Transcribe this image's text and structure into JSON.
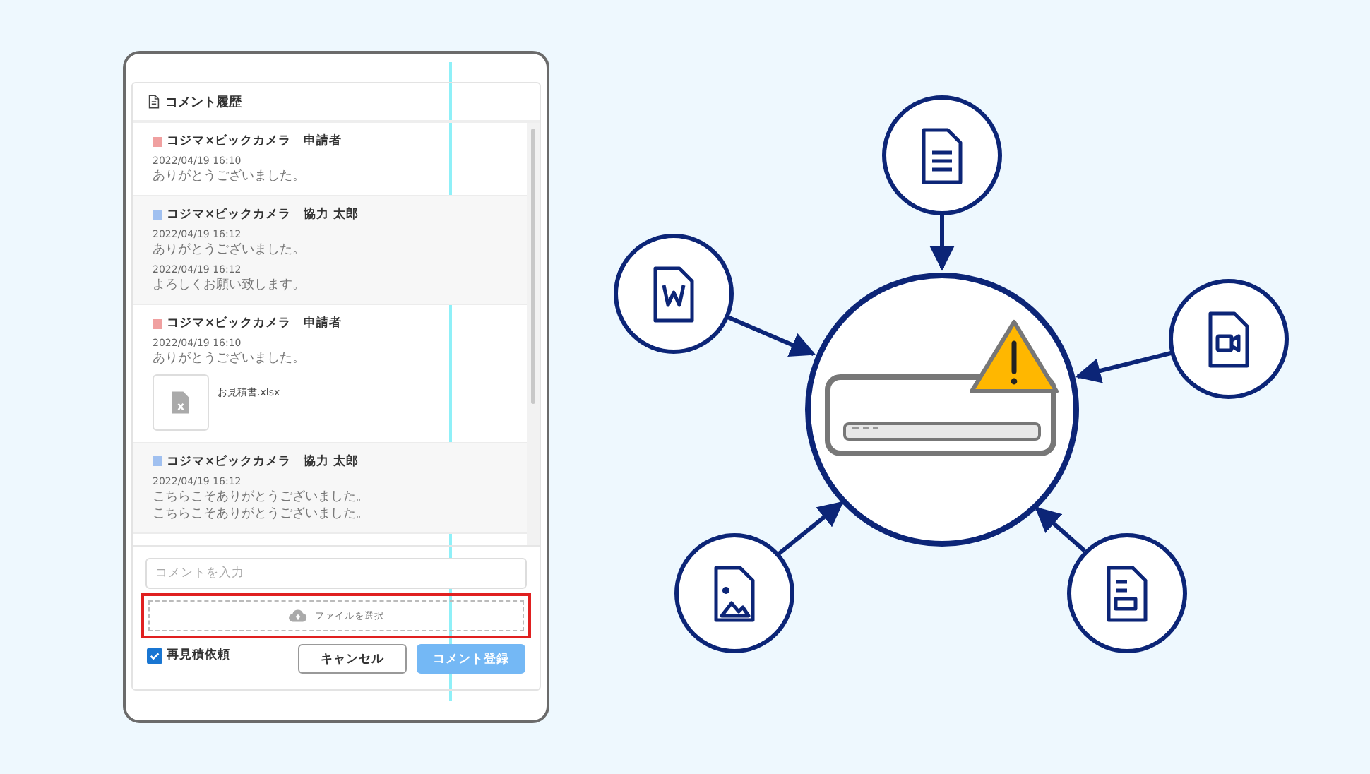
{
  "panel": {
    "title": "コメント履歴",
    "comments": [
      {
        "color": "#f0a0a0",
        "author": "コジマ×ビックカメラ　申請者",
        "entries": [
          {
            "time": "2022/04/19 16:10",
            "text": "ありがとうございました。"
          }
        ]
      },
      {
        "color": "#a0c0f0",
        "author": "コジマ×ビックカメラ　協力 太郎",
        "entries": [
          {
            "time": "2022/04/19 16:12",
            "text": "ありがとうございました。"
          },
          {
            "time": "2022/04/19 16:12",
            "text": "よろしくお願い致します。"
          }
        ]
      },
      {
        "color": "#f0a0a0",
        "author": "コジマ×ビックカメラ　申請者",
        "entries": [
          {
            "time": "2022/04/19 16:10",
            "text": "ありがとうございました。"
          }
        ],
        "attachment": {
          "name": "お見積書.xlsx"
        }
      },
      {
        "color": "#a0c0f0",
        "author": "コジマ×ビックカメラ　協力 太郎",
        "entries": [
          {
            "time": "2022/04/19 16:12",
            "text": "こちらこそありがとうございました。"
          },
          {
            "text": "こちらこそありがとうございました。"
          }
        ]
      }
    ],
    "comment_input": {
      "placeholder": "コメントを入力"
    },
    "file_select": {
      "label": "ファイルを選択"
    },
    "re_estimate": {
      "label": "再見積依頼",
      "checked": true
    },
    "buttons": [
      {
        "label": "キャンセル",
        "kind": "secondary"
      },
      {
        "label": "コメント登録",
        "kind": "primary"
      }
    ]
  }
}
